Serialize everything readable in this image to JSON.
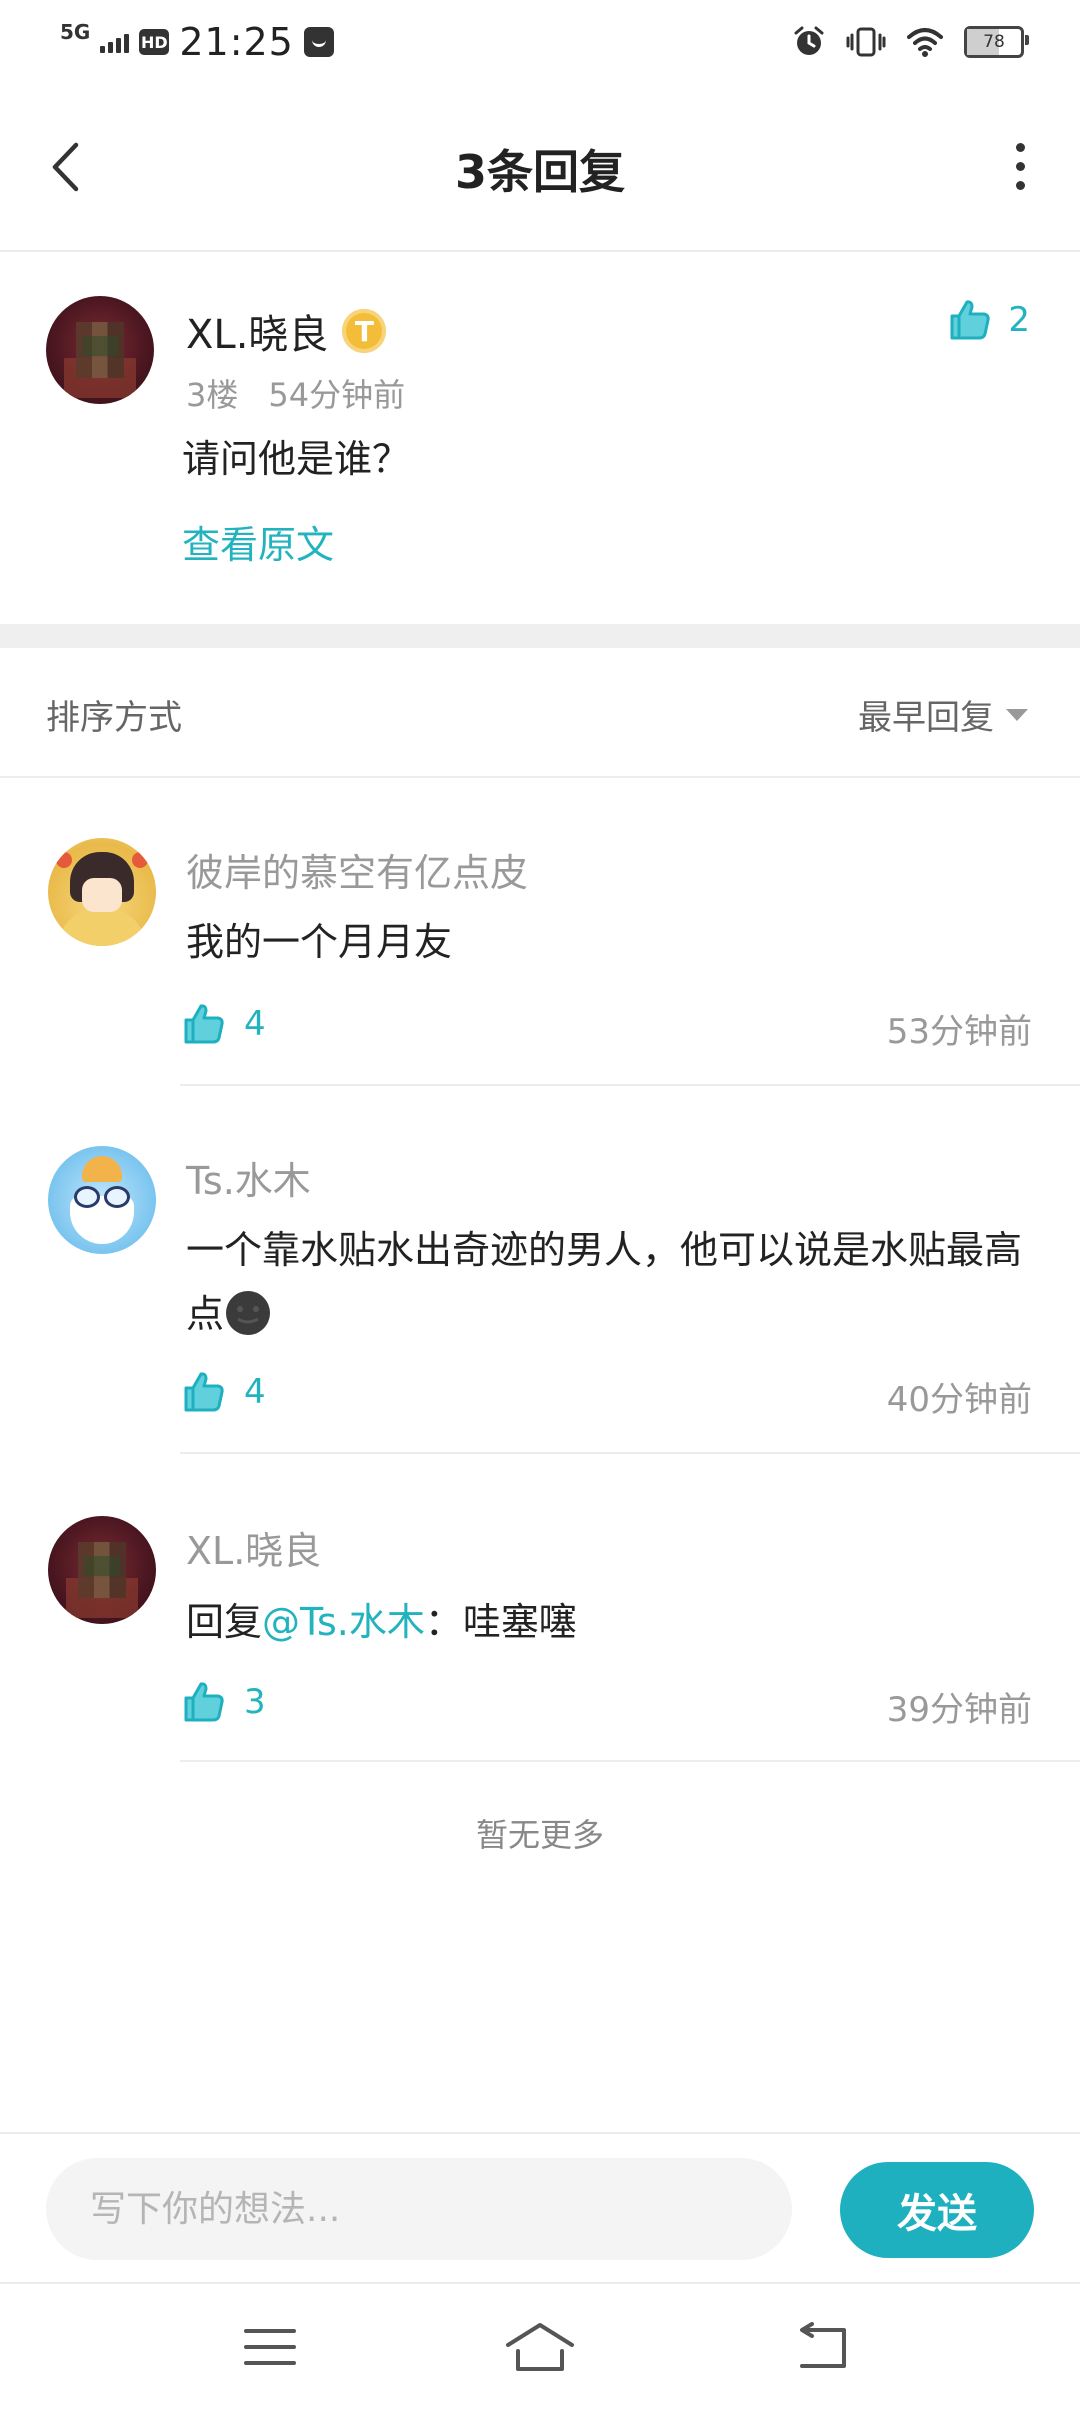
{
  "status_bar": {
    "network": "5G",
    "hd": "HD",
    "time": "21:25",
    "battery": "78"
  },
  "header": {
    "title": "3条回复"
  },
  "main_comment": {
    "author": "XL.晓良",
    "badge": "T",
    "likes": "2",
    "floor": "3楼",
    "time": "54分钟前",
    "text": "请问他是谁？",
    "view_original": "查看原文"
  },
  "sort": {
    "label": "排序方式",
    "selected": "最早回复"
  },
  "replies": [
    {
      "author": "彼岸的慕空有亿点皮",
      "text": "我的一个月月友",
      "likes": "4",
      "time": "53分钟前"
    },
    {
      "author": "Ts.水木",
      "text": "一个靠水贴水出奇迹的男人，他可以说是水贴最高点",
      "likes": "4",
      "time": "40分钟前"
    },
    {
      "author": "XL.晓良",
      "text_prefix": "回复",
      "mention": "@Ts.水木",
      "text_suffix": "：哇塞噻",
      "likes": "3",
      "time": "39分钟前"
    }
  ],
  "end_note": "暂无更多",
  "composer": {
    "placeholder": "写下你的想法...",
    "send_label": "发送"
  },
  "colors": {
    "accent": "#1fb0bf",
    "badge": "#f3bd3a"
  },
  "icons": [
    "back-arrow-icon",
    "more-vertical-icon",
    "thumbs-up-icon",
    "dropdown-triangle-icon",
    "menu-icon",
    "home-icon",
    "back-icon"
  ]
}
